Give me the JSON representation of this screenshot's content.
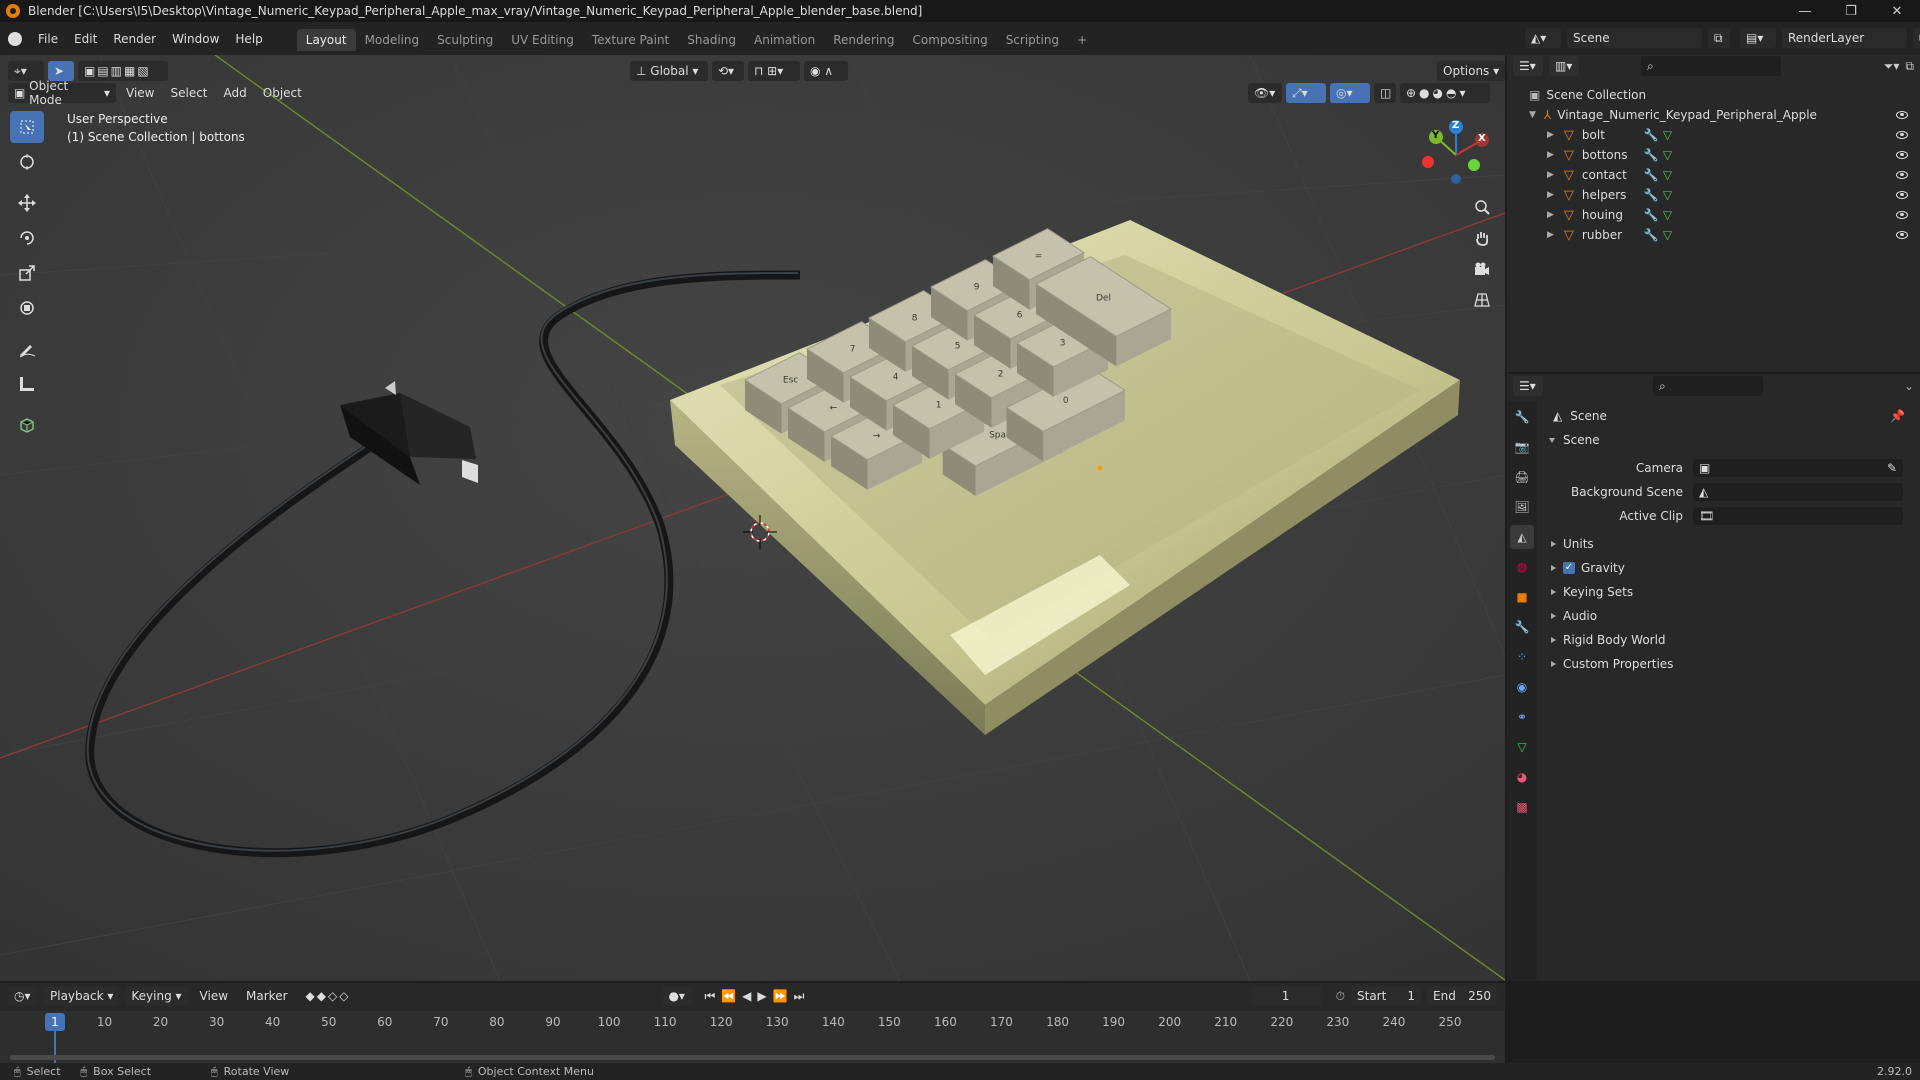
{
  "window": {
    "title": "Blender [C:\\Users\\I5\\Desktop\\Vintage_Numeric_Keypad_Peripheral_Apple_max_vray/Vintage_Numeric_Keypad_Peripheral_Apple_blender_base.blend]",
    "minimize": "—",
    "maximize": "❐",
    "close": "✕"
  },
  "menu": [
    "File",
    "Edit",
    "Render",
    "Window",
    "Help"
  ],
  "workspaces": [
    "Layout",
    "Modeling",
    "Sculpting",
    "UV Editing",
    "Texture Paint",
    "Shading",
    "Animation",
    "Rendering",
    "Compositing",
    "Scripting"
  ],
  "workspace_add": "+",
  "top_right": {
    "scene": "Scene",
    "render_layer": "RenderLayer"
  },
  "viewport": {
    "mode": "Object Mode",
    "menus": [
      "View",
      "Select",
      "Add",
      "Object"
    ],
    "transform": "Global",
    "options": "Options",
    "overlay_line1": "User Perspective",
    "overlay_line2": "(1) Scene Collection | bottons",
    "gizmo": {
      "x": "X",
      "y": "Y",
      "z": "Z"
    },
    "keys": [
      "Esc",
      "←",
      "→",
      "Space",
      "0",
      "7",
      "8",
      "9",
      "4",
      "5",
      "6",
      "1",
      "2",
      "3",
      "Del",
      "="
    ]
  },
  "outliner": {
    "root": "Scene Collection",
    "collection": "Vintage_Numeric_Keypad_Peripheral_Apple",
    "items": [
      "bolt",
      "bottons",
      "contact",
      "helpers",
      "houing",
      "rubber"
    ]
  },
  "properties": {
    "header": "Scene",
    "panel": "Scene",
    "fields": [
      {
        "label": "Camera"
      },
      {
        "label": "Background Scene"
      },
      {
        "label": "Active Clip"
      }
    ],
    "subpanels": [
      "Units",
      "Gravity",
      "Keying Sets",
      "Audio",
      "Rigid Body World",
      "Custom Properties"
    ],
    "gravity_checked": true
  },
  "timeline": {
    "menus": [
      "Playback",
      "Keying",
      "View",
      "Marker"
    ],
    "current_frame": "1",
    "start_label": "Start",
    "start": "1",
    "end_label": "End",
    "end": "250",
    "frame_marker": "1",
    "ticks": [
      10,
      20,
      30,
      40,
      50,
      60,
      70,
      80,
      90,
      100,
      110,
      120,
      130,
      140,
      150,
      160,
      170,
      180,
      190,
      200,
      210,
      220,
      230,
      240,
      250
    ]
  },
  "status": {
    "select": "Select",
    "box_select": "Box Select",
    "rotate": "Rotate View",
    "context": "Object Context Menu",
    "version": "2.92.0"
  },
  "colors": {
    "accent": "#4772b3",
    "object_orange": "#e87d0d",
    "mesh_green": "#4fc25a",
    "keypad_body": "#cfcf9e"
  }
}
